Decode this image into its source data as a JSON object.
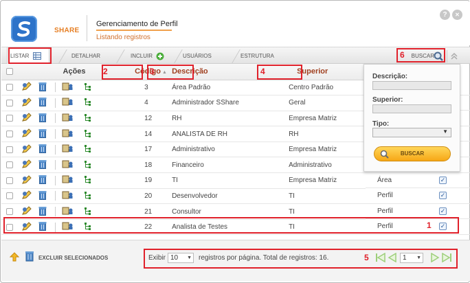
{
  "header": {
    "app_name": "SHARE",
    "page_title": "Gerenciamento de Perfil",
    "subtitle": "Listando registros",
    "help_glyph": "?",
    "close_glyph": "✕"
  },
  "toolbar": {
    "listar": "LISTAR",
    "detalhar": "DETALHAR",
    "incluir": "INCLUIR",
    "usuarios": "USUÁRIOS",
    "estrutura": "ESTRUTURA",
    "buscar": "BUSCAR"
  },
  "table": {
    "col_acoes": "Ações",
    "col_codigo": "Código",
    "col_descricao": "Descrição",
    "col_superior": "Superior",
    "rows": [
      {
        "codigo": "3",
        "descricao": "Área Padrão",
        "superior": "Centro Padrão",
        "tipo": "",
        "ativo": false
      },
      {
        "codigo": "4",
        "descricao": "Administrador SShare",
        "superior": "Geral",
        "tipo": "",
        "ativo": false
      },
      {
        "codigo": "12",
        "descricao": "RH",
        "superior": "Empresa Matriz",
        "tipo": "",
        "ativo": false
      },
      {
        "codigo": "14",
        "descricao": "ANALISTA DE RH",
        "superior": "RH",
        "tipo": "",
        "ativo": false
      },
      {
        "codigo": "17",
        "descricao": "Administrativo",
        "superior": "Empresa Matriz",
        "tipo": "",
        "ativo": false
      },
      {
        "codigo": "18",
        "descricao": "Financeiro",
        "superior": "Administrativo",
        "tipo": "",
        "ativo": false
      },
      {
        "codigo": "19",
        "descricao": "TI",
        "superior": "Empresa Matriz",
        "tipo": "Área",
        "ativo": true
      },
      {
        "codigo": "20",
        "descricao": "Desenvolvedor",
        "superior": "TI",
        "tipo": "Perfil",
        "ativo": true
      },
      {
        "codigo": "21",
        "descricao": "Consultor",
        "superior": "TI",
        "tipo": "Perfil",
        "ativo": true
      },
      {
        "codigo": "22",
        "descricao": "Analista de Testes",
        "superior": "TI",
        "tipo": "Perfil",
        "ativo": true
      }
    ]
  },
  "search_panel": {
    "descricao_label": "Descrição:",
    "superior_label": "Superior:",
    "tipo_label": "Tipo:",
    "button": "BUSCAR"
  },
  "footer": {
    "excluir": "EXCLUIR SELECIONADOS",
    "exibir": "Exibir",
    "per_page_value": "10",
    "per_page_text": "registros por página. Total de registros: 16.",
    "page_value": "1"
  },
  "annotations": {
    "n1": "1",
    "n2": "2",
    "n3": "3",
    "n4": "4",
    "n5": "5",
    "n6": "6"
  },
  "colors": {
    "accent": "#e67e22",
    "highlight": "#e0202a",
    "brand": "#2d73c9"
  }
}
